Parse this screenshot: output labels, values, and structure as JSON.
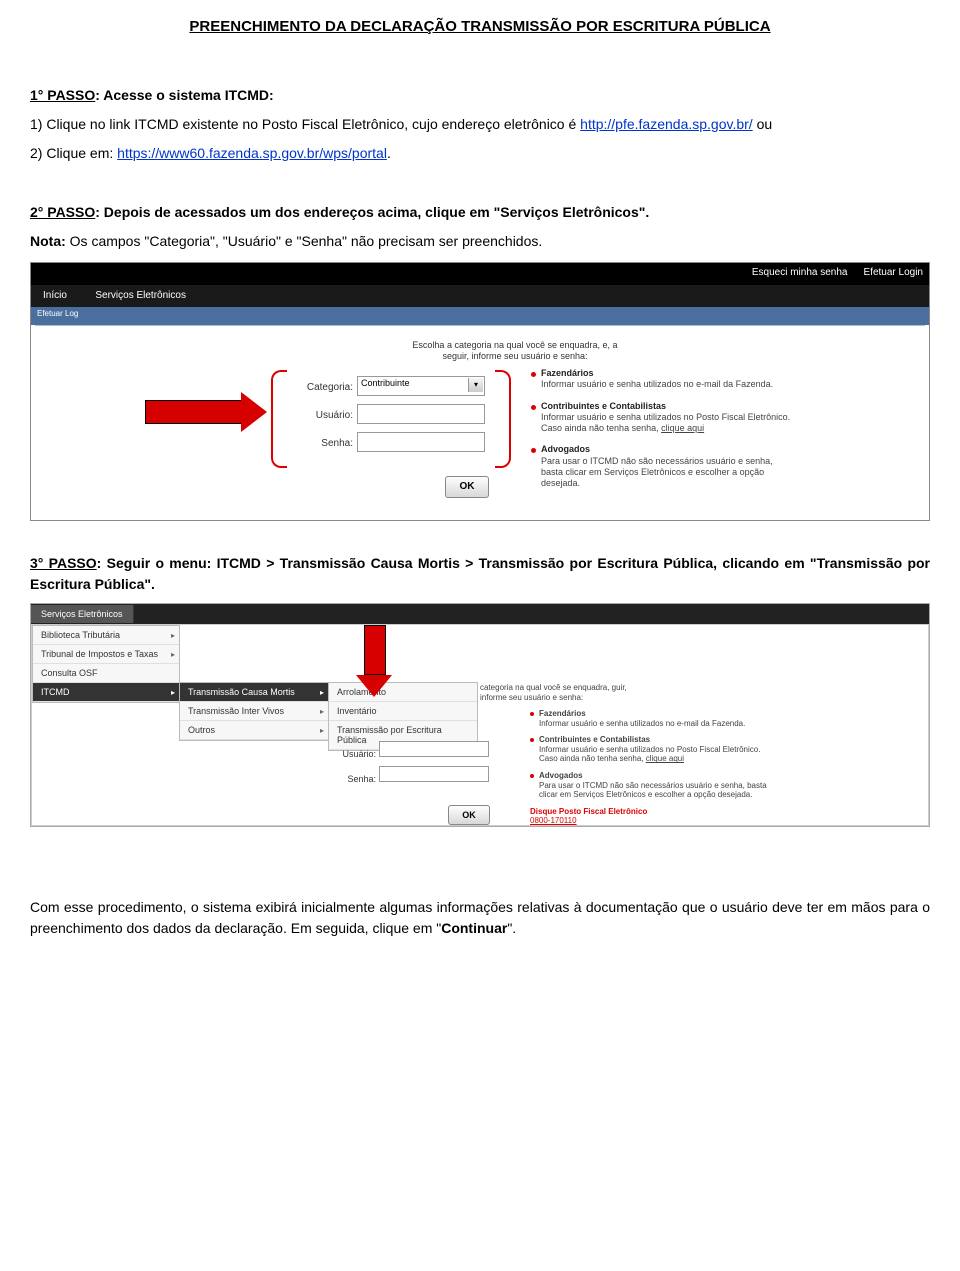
{
  "title": "PREENCHIMENTO DA DECLARAÇÃO TRANSMISSÃO POR ESCRITURA PÚBLICA",
  "p1": {
    "step": "1° PASSO",
    "rest": ": Acesse o sistema ITCMD:",
    "line1a": "1) Clique no link ITCMD existente no Posto Fiscal Eletrônico, cujo endereço eletrônico é ",
    "link1": "http://pfe.fazenda.sp.gov.br/",
    "line1b": " ou",
    "line2a": "2) Clique em: ",
    "link2": "https://www60.fazenda.sp.gov.br/wps/portal",
    "line2b": "."
  },
  "p2": {
    "step": "2° PASSO",
    "rest": ": Depois de acessados um dos endereços acima, clique em \"Serviços Eletrônicos\"."
  },
  "nota": {
    "label": "Nota:",
    "text": " Os campos \"Categoria\", \"Usuário\" e \"Senha\" não precisam ser preenchidos."
  },
  "shot1": {
    "top_right": {
      "a": "Esqueci minha senha",
      "b": "Efetuar Login"
    },
    "tabs": {
      "a": "Início",
      "b": "Serviços Eletrônicos"
    },
    "bluebar": "Efetuar Log",
    "intro": "Escolha a categoria na qual você se enquadra, e, a seguir, informe seu usuário e senha:",
    "labels": {
      "cat": "Categoria:",
      "usr": "Usuário:",
      "pwd": "Senha:"
    },
    "cat_value": "Contribuinte",
    "ok": "OK",
    "side": {
      "a_t": "Fazendários",
      "a": "Informar usuário e senha utilizados no e-mail da Fazenda.",
      "b_t": "Contribuintes e Contabilistas",
      "b": "Informar usuário e senha utilizados no Posto Fiscal Eletrônico.",
      "b2": "Caso ainda não tenha senha, ",
      "b3": "clique aqui",
      "c_t": "Advogados",
      "c": "Para usar o ITCMD não são necessários usuário e senha, basta clicar em Serviços Eletrônicos e escolher a opção desejada."
    }
  },
  "p3": {
    "step": "3° PASSO",
    "rest": ": Seguir o menu: ITCMD > Transmissão Causa Mortis > Transmissão por Escritura Pública, clicando em \"Transmissão por Escritura Pública\"."
  },
  "shot2": {
    "tab": "Serviços Eletrônicos",
    "col1": {
      "a": "Biblioteca Tributária",
      "b": "Tribunal de Impostos e Taxas",
      "c": "Consulta OSF",
      "d": "ITCMD"
    },
    "col2": {
      "a": "Transmissão Causa Mortis",
      "b": "Transmissão Inter Vivos",
      "c": "Outros"
    },
    "col3": {
      "a": "Arrolamento",
      "b": "Inventário",
      "c": "Transmissão por Escritura Pública"
    },
    "intro": "categoria na qual você se enquadra, guir, informe seu usuário e senha:",
    "labels": {
      "usr": "Usuário:",
      "pwd": "Senha:"
    },
    "ok": "OK",
    "side": {
      "a_t": "Fazendários",
      "a": "Informar usuário e senha utilizados no e-mail da Fazenda.",
      "b_t": "Contribuintes e Contabilistas",
      "b": "Informar usuário e senha utilizados no Posto Fiscal Eletrônico.",
      "b2": "Caso ainda não tenha senha, ",
      "b3": "clique aqui",
      "c_t": "Advogados",
      "c": "Para usar o ITCMD não são necessários usuário e senha, basta clicar em Serviços Eletrônicos e escolher a opção desejada.",
      "d": "Disque Posto Fiscal Eletrônico",
      "d2": "0800-170110"
    }
  },
  "p4": "Com esse procedimento, o sistema exibirá inicialmente algumas informações relativas à documentação que o usuário deve ter em mãos para o preenchimento dos dados da declaração. Em seguida, clique em \"",
  "p4b": "Continuar",
  "p4c": "\"."
}
